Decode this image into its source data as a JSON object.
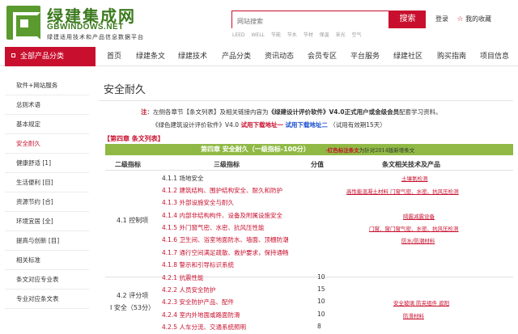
{
  "header": {
    "logo_cn": "绿建集成网",
    "logo_en": "GBWINDOWS.NET",
    "slogan": "绿建适用技术和产品信息数据平台",
    "search_placeholder": "网站搜索",
    "search_button": "搜索",
    "hot_words": [
      "LEED",
      "WELL",
      "节能",
      "节水",
      "节材",
      "保温",
      "采光",
      "空气"
    ],
    "login": "登录",
    "favorite": "我的收藏"
  },
  "nav": {
    "category": "全部产品分类",
    "items": [
      "首页",
      "绿建条文",
      "绿建技术",
      "产品分类",
      "资讯动态",
      "会员专区",
      "平台服务",
      "绿建社区",
      "购买指南",
      "项目信息"
    ]
  },
  "sidebar": {
    "items": [
      "软件+网站服务",
      "总则术语",
      "基本规定",
      "安全耐久",
      "健康舒适 [1]",
      "生活便利 [目]",
      "资源节约 [合]",
      "环境宜居 [全]",
      "提高与创新 [目]",
      "相关标准",
      "条文对应专业表",
      "专业对应条文表"
    ],
    "active_index": 3
  },
  "main": {
    "title": "安全耐久",
    "note1": {
      "prefix": "注",
      "text1": "：左侧各章节【条文列表】及相关链接内容为",
      "bold": "《绿建设计评价软件》V4.0正式用户或金级会员",
      "text2": "配套学习资料。"
    },
    "note2": {
      "text1": "《绿色建筑设计评价软件》V4.0",
      "link1": "试用下载地址一",
      "link2": "试用下载地址二",
      "text2": "（试用有效期15天）"
    },
    "section_tag": "【第四章 条文列表】",
    "chapter_title": "第四章 安全耐久（一级指标-100分）",
    "chapter_note_red": "-红色标注条文",
    "chapter_note_black": "为针对2014版新增条文",
    "columns": [
      "二级指标",
      "三级指标",
      "分值",
      "条文相关技术及产品"
    ],
    "group1_label": "4.1 控制项",
    "group2_label_line1": "4.2 评分项",
    "group2_label_line2": "Ⅰ 安全（53分）",
    "rows": [
      {
        "std": "4.1.1 场地安全",
        "score": "",
        "red": false
      },
      {
        "std": "4.1.2 建筑结构、围护结构安全、耐久和防护",
        "score": "",
        "red": true
      },
      {
        "std": "4.1.3 外部设施安全与耐久",
        "score": "",
        "red": true
      },
      {
        "std": "4.1.4 内部非结构构件、设备及附属设施安全",
        "score": "",
        "red": true
      },
      {
        "std": "4.1.5 外门窗气密、水密、抗风压性能",
        "score": "",
        "red": true
      },
      {
        "std": "4.1.6 卫生间、浴室地面防水、墙面、顶棚防潮",
        "score": "",
        "red": true
      },
      {
        "std": "4.1.7 通行空间满足疏散、救护要求，保持通畅",
        "score": "",
        "red": true
      },
      {
        "std": "4.1.8 警示和引导标识系统",
        "score": "",
        "red": true
      },
      {
        "std": "4.2.1 抗震性能",
        "score": "10",
        "red": true
      },
      {
        "std": "4.2.2 人员安全防护",
        "score": "15",
        "red": true
      },
      {
        "std": "4.2.3 安全防护产品、配件",
        "score": "10",
        "red": true
      },
      {
        "std": "4.2.4 室内外地面或路面防滑",
        "score": "10",
        "red": true
      },
      {
        "std": "4.2.5 人车分流、交通系统照明",
        "score": "8",
        "red": true
      }
    ],
    "products": {
      "p1": "土壤氡检测",
      "p2": "高性能混凝土材料  门窗气密、水密、抗风压检测",
      "p3": "隔震减震设备",
      "p4": "门窗、窗门窗气密、水密、抗风压检测",
      "p5": "防水/防潮材料",
      "p6": "安全玻璃  防夹组件  遮阳",
      "p7": "防滑材料"
    }
  }
}
